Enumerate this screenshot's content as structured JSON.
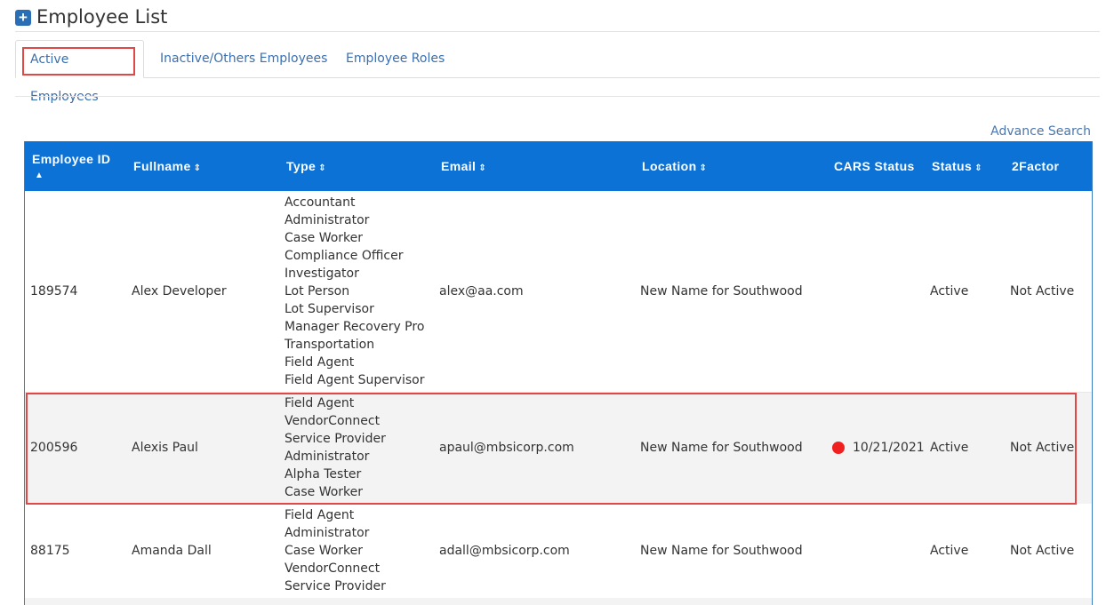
{
  "page": {
    "title": "Employee List"
  },
  "tabs": [
    {
      "label": "Active Employees"
    },
    {
      "label": "Inactive/Others Employees"
    },
    {
      "label": "Employee Roles"
    }
  ],
  "advance_search": "Advance Search",
  "table": {
    "headers": {
      "employee_id": "Employee ID",
      "fullname": "Fullname",
      "type": "Type",
      "email": "Email",
      "location": "Location",
      "cars_status": "CARS Status",
      "status": "Status",
      "two_factor": "2Factor"
    },
    "rows": [
      {
        "employee_id": "189574",
        "fullname": "Alex Developer",
        "types": [
          "Accountant",
          "Administrator",
          "Case Worker",
          "Compliance Officer",
          "Investigator",
          "Lot Person",
          "Lot Supervisor",
          "Manager Recovery Pro",
          "Transportation",
          "Field Agent",
          "Field Agent Supervisor"
        ],
        "email": "alex@aa.com",
        "location": "New Name for Southwood",
        "cars_status": "",
        "status": "Active",
        "two_factor": "Not Active"
      },
      {
        "employee_id": "200596",
        "fullname": "Alexis Paul",
        "types": [
          "Field Agent",
          "VendorConnect Service Provider",
          "Administrator",
          "Alpha Tester",
          "Case Worker"
        ],
        "email": "apaul@mbsicorp.com",
        "location": "New Name for Southwood",
        "cars_status": "10/21/2021",
        "cars_status_color": "#f02020",
        "status": "Active",
        "two_factor": "Not Active"
      },
      {
        "employee_id": "88175",
        "fullname": "Amanda Dall",
        "types": [
          "Field Agent",
          "Administrator",
          "Case Worker",
          "VendorConnect Service Provider"
        ],
        "email": "adall@mbsicorp.com",
        "location": "New Name for Southwood",
        "cars_status": "",
        "status": "Active",
        "two_factor": "Not Active"
      }
    ]
  },
  "colors": {
    "header_bg": "#0c72d6",
    "link": "#3a6fb0",
    "highlight": "#e04848"
  }
}
